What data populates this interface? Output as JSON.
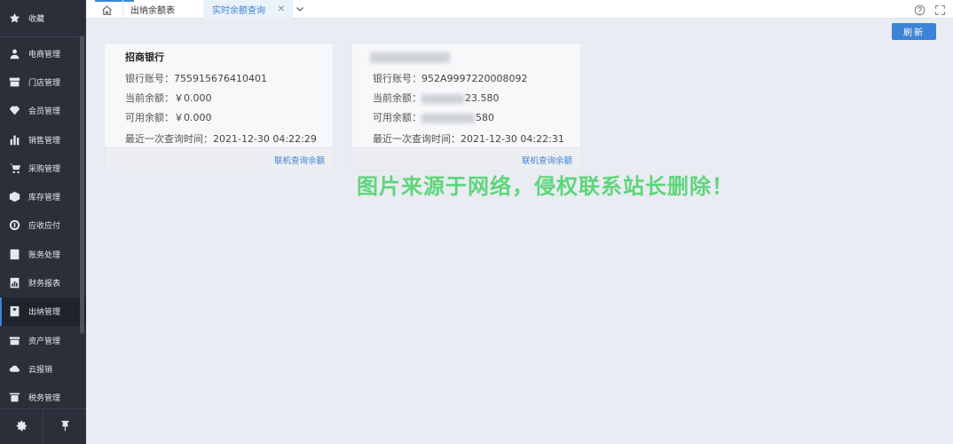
{
  "sidebar": {
    "top_label": "收藏",
    "items": [
      {
        "label": "电商管理",
        "icon": "user-icon"
      },
      {
        "label": "门店管理",
        "icon": "store-icon"
      },
      {
        "label": "会员管理",
        "icon": "diamond-icon"
      },
      {
        "label": "销售管理",
        "icon": "bar-chart-icon"
      },
      {
        "label": "采购管理",
        "icon": "cart-icon"
      },
      {
        "label": "库存管理",
        "icon": "box-icon"
      },
      {
        "label": "应收应付",
        "icon": "coin-icon"
      },
      {
        "label": "账务处理",
        "icon": "ledger-icon"
      },
      {
        "label": "财务报表",
        "icon": "report-icon"
      },
      {
        "label": "出纳管理",
        "icon": "cashier-icon",
        "active": true
      },
      {
        "label": "资产管理",
        "icon": "asset-icon"
      },
      {
        "label": "云报销",
        "icon": "cloud-reimburse-icon"
      },
      {
        "label": "税务管理",
        "icon": "tax-icon"
      }
    ]
  },
  "tabs": [
    {
      "label": "出纳余额表"
    },
    {
      "label": "实时余额查询",
      "active": true,
      "close": "✕"
    }
  ],
  "toolbar": {
    "refresh_label": "刷新"
  },
  "cards": [
    {
      "title": "招商银行",
      "account_label": "银行账号：",
      "account_value": "755915676410401",
      "current_label": "当前余额：",
      "current_value": "￥0.000",
      "available_label": "可用余额：",
      "available_value": "￥0.000",
      "time_label": "最近一次查询时间：",
      "time_value": "2021-12-30 04:22:29",
      "link": "联机查询余额"
    },
    {
      "title": "",
      "account_label": "银行账号：",
      "account_value": "952A9997220008092",
      "current_label": "当前余额：",
      "current_value": "23.580",
      "available_label": "可用余额：",
      "available_value": "580",
      "time_label": "最近一次查询时间：",
      "time_value": "2021-12-30 04:22:31",
      "link": "联机查询余额"
    }
  ],
  "watermark": "图片来源于网络，侵权联系站长删除！",
  "colors": {
    "accent": "#3c84d8",
    "sidebar_bg": "#2a2f3a",
    "watermark": "#5dd67a"
  }
}
